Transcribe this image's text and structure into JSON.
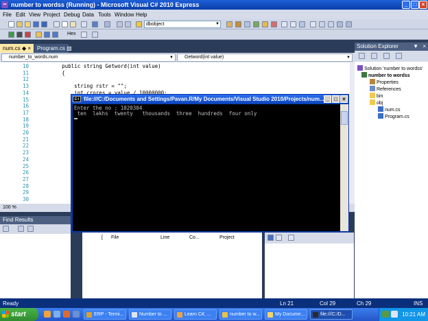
{
  "window": {
    "title": "number to wordss (Running) - Microsoft Visual C# 2010 Express"
  },
  "menu": [
    "File",
    "Edit",
    "View",
    "Project",
    "Debug",
    "Data",
    "Tools",
    "Window",
    "Help"
  ],
  "toolbar": {
    "config_combo": "dbobject",
    "hex_label": "Hex"
  },
  "tabs": [
    {
      "label": "num.cs"
    },
    {
      "label": "Program.cs"
    }
  ],
  "nav": {
    "class_combo": "number_to_words.num",
    "member_combo": "Getword(int value)"
  },
  "editor": {
    "zoom": "100 %",
    "lines": [
      {
        "num": "10",
        "code": "        public string Getword(int value)"
      },
      {
        "num": "11",
        "code": "        {"
      },
      {
        "num": "12",
        "code": ""
      },
      {
        "num": "13",
        "code": "            string rstr = \"\";"
      },
      {
        "num": "14",
        "code": "            int crores = value / 10000000;"
      },
      {
        "num": "15",
        "code": ""
      },
      {
        "num": "16",
        "code": ""
      },
      {
        "num": "17",
        "code": ""
      },
      {
        "num": "18",
        "code": ""
      },
      {
        "num": "19",
        "code": ""
      },
      {
        "num": "20",
        "code": ""
      },
      {
        "num": "21",
        "code": ""
      },
      {
        "num": "22",
        "code": ""
      },
      {
        "num": "23",
        "code": ""
      },
      {
        "num": "24",
        "code": ""
      },
      {
        "num": "25",
        "code": ""
      },
      {
        "num": "26",
        "code": ""
      },
      {
        "num": "27",
        "code": ""
      },
      {
        "num": "28",
        "code": ""
      },
      {
        "num": "29",
        "code": ""
      },
      {
        "num": "30",
        "code": ""
      }
    ]
  },
  "console": {
    "title": "file:///C:/Documents and Settings/Pavan.R/My Documents/Visual Studio 2010/Projects/num...",
    "lines": [
      "Enter the no : 1020304",
      " ten  lakhs  twenty   thousands  three  hundreds  four only"
    ]
  },
  "find_results": {
    "title": "Find Results"
  },
  "results_columns": [
    "File",
    "Line",
    "Co...",
    "Project"
  ],
  "solution_explorer": {
    "title": "Solution Explorer",
    "items": [
      {
        "label": "Solution 'number to wordss'",
        "bold": false
      },
      {
        "label": "number to wordss",
        "bold": true
      },
      {
        "label": "Properties",
        "bold": false
      },
      {
        "label": "References",
        "bold": false
      },
      {
        "label": "bin",
        "bold": false
      },
      {
        "label": "obj",
        "bold": false
      },
      {
        "label": "num.cs",
        "bold": false
      },
      {
        "label": "Program.cs",
        "bold": false
      }
    ]
  },
  "status": {
    "ready": "Ready",
    "ln": "Ln 21",
    "col": "Col 29",
    "ch": "Ch 29",
    "ins": "INS"
  },
  "taskbar": {
    "start": "start",
    "buttons": [
      "ERP - Termi...",
      "Number to ...",
      "Learn C#, ...",
      "number to w...",
      "My Docume...",
      "file:///C:/D..."
    ],
    "clock": "10:21 AM"
  },
  "colors": {
    "title_bar": "#1e5fd8",
    "ide_frame": "#2b3c59",
    "console_bg": "#000000",
    "taskbar": "#2456c8"
  }
}
